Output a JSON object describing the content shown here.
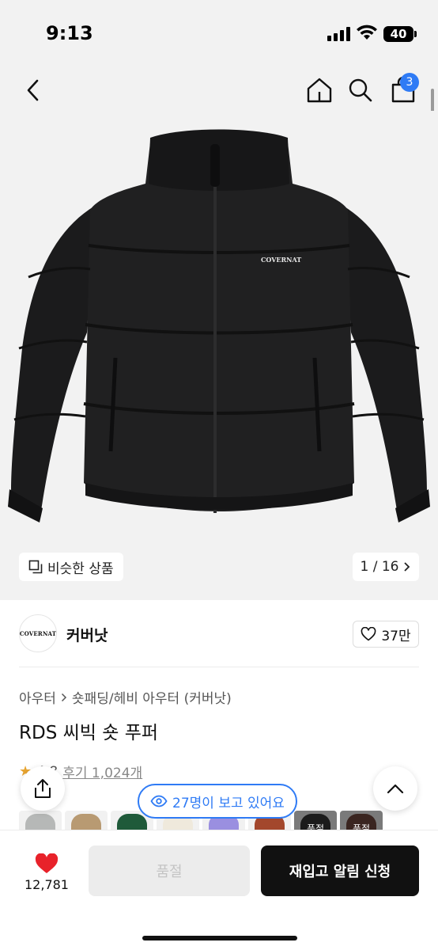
{
  "status_bar": {
    "time": "9:13",
    "battery": "40"
  },
  "header": {
    "cart_count": "3",
    "icons": [
      "chevron-left-icon",
      "home-icon",
      "search-icon",
      "shopping-bag-icon"
    ]
  },
  "gallery": {
    "similar_label": "비슷한 상품",
    "page_indicator": "1 / 16",
    "jacket_logo": "COVERNAT",
    "colors": {
      "background": "#f2f2f2",
      "jacket": "#1b1b1c"
    }
  },
  "brand": {
    "logo_text": "COVERNAT",
    "name": "커버낫",
    "likes": "37만"
  },
  "breadcrumb": {
    "category": "아우터",
    "subcategory": "숏패딩/헤비 아우터 (커버낫)"
  },
  "product": {
    "title": "RDS 씨빅 숏 푸퍼",
    "rating": "4.8",
    "reviews": "후기 1,024개"
  },
  "viewers": {
    "text": "27명이 보고 있어요"
  },
  "thumbnails": [
    {
      "color": "#b6b8b7",
      "label": ""
    },
    {
      "color": "#b89a72",
      "label": ""
    },
    {
      "color": "#1f5a3a",
      "label": ""
    },
    {
      "color": "#efe9dc",
      "label": ""
    },
    {
      "color": "#9a8fe0",
      "label": ""
    },
    {
      "color": "#a3472c",
      "label": ""
    },
    {
      "color": "#1b1b1b",
      "label": "품절"
    },
    {
      "color": "#3a2520",
      "label": "품절"
    }
  ],
  "bottom_bar": {
    "wish_count": "12,781",
    "soldout_label": "품절",
    "restock_label": "재입고 알림 신청"
  },
  "colors": {
    "accent": "#2f7bf5",
    "heart": "#e8222a",
    "primary_button": "#111111"
  }
}
